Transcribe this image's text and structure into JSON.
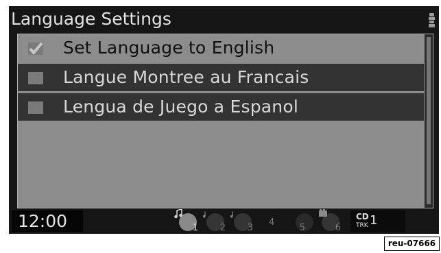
{
  "header": {
    "title": "Language Settings"
  },
  "languages": [
    {
      "label": "Set Language to English",
      "checked": true
    },
    {
      "label": "Langue Montree au Francais",
      "checked": false
    },
    {
      "label": "Lengua de Juego a Espanol",
      "checked": false
    }
  ],
  "status_bar": {
    "clock": "12:00",
    "disc_slots": [
      "1",
      "2",
      "3",
      "4",
      "5",
      "6"
    ],
    "cd_label": "CD",
    "trk_label": "TRK",
    "track_number": "1"
  },
  "reference_code": "reu-07666",
  "colors": {
    "screen_bg": "#161616",
    "selected_row_bg": "#8c8c8c",
    "unselected_row_bg": "#333333",
    "checkbox_fill": "#7a7a7a"
  }
}
